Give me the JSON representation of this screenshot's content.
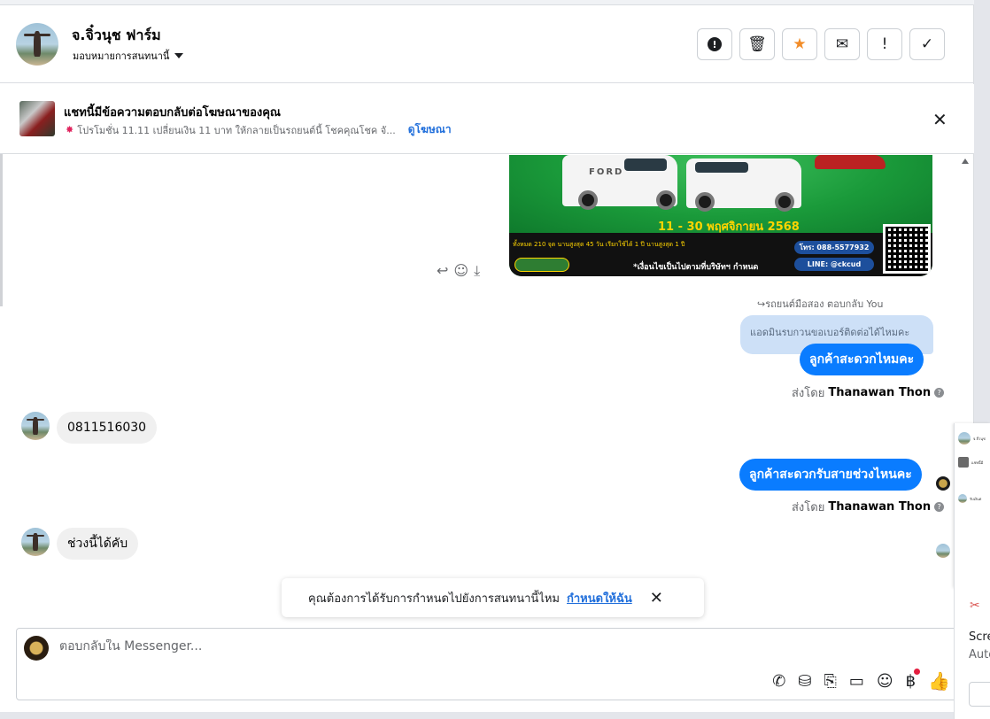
{
  "header": {
    "contact_name": "จ.จิ๋วนุช ฟาร์ม",
    "assign_label": "มอบหมายการสนทนานี้",
    "tools": [
      {
        "name": "spam",
        "glyph": "!"
      },
      {
        "name": "delete",
        "glyph": "🗑"
      },
      {
        "name": "follow-up",
        "glyph": "★"
      },
      {
        "name": "mark-unread",
        "glyph": "✉"
      },
      {
        "name": "priority",
        "glyph": "!"
      },
      {
        "name": "done",
        "glyph": "✓"
      }
    ]
  },
  "ad_banner": {
    "title": "แชทนี้มีข้อความตอบกลับต่อโฆษณาของคุณ",
    "description": "โปรโมชั่น 11.11 เปลี่ยนเงิน 11 บาท ให้กลายเป็นรถยนต์นี้ โชคคุณโชค จั...",
    "link": "ดูโฆษณา"
  },
  "ad_image": {
    "date_text": "11 - 30 พฤศจิกายน 2568",
    "phone": "โทร: 088-5577932",
    "line": "LINE: @ckcud",
    "stats": "ทั้งหมด 210 จุด   นานสูงสุด 45 วัน   เรียกใช้ได้ 1 ปี   นานสูงสุด 1 ปี",
    "note": "*เงื่อนไขเป็นไปตามที่บริษัทฯ กำหนด",
    "brand": "FORD"
  },
  "messages": {
    "reply_label": "รถยนต์มือสอง ตอบกลับ You",
    "quoted_text": "แอดมินรบกวนขอเบอร์ติดต่อได้ไหมคะ",
    "out1": "ลูกค้าสะดวกไหมคะ",
    "sent_by_prefix": "ส่งโดย",
    "sent_by_name": "Thanawan Thon",
    "in1": "0811516030",
    "out2": "ลูกค้าสะดวกรับสายช่วงไหนคะ",
    "sent_by_prefix_2": "ส่งโดย",
    "sent_by_name_2": "Thanawan Thon",
    "in2": "ช่วงนี้ได้คับ"
  },
  "toast": {
    "text": "คุณต้องการได้รับการกำหนดไปยังการสนทนานี้ไหม",
    "action": "กำหนดให้ฉัน"
  },
  "composer": {
    "placeholder": "ตอบกลับใน Messenger..."
  },
  "side_panel": {
    "row1": "จ.จิ๋วนุช",
    "row2": "แชทนี้มี",
    "row3": "รับเงินด่",
    "card_title": "Scre",
    "card_sub": "Auto"
  },
  "colors": {
    "accent_blue": "#0a7cff",
    "link_blue": "#216fdb",
    "quoted_bg": "#cde0f7",
    "star_orange": "#f28c28"
  }
}
